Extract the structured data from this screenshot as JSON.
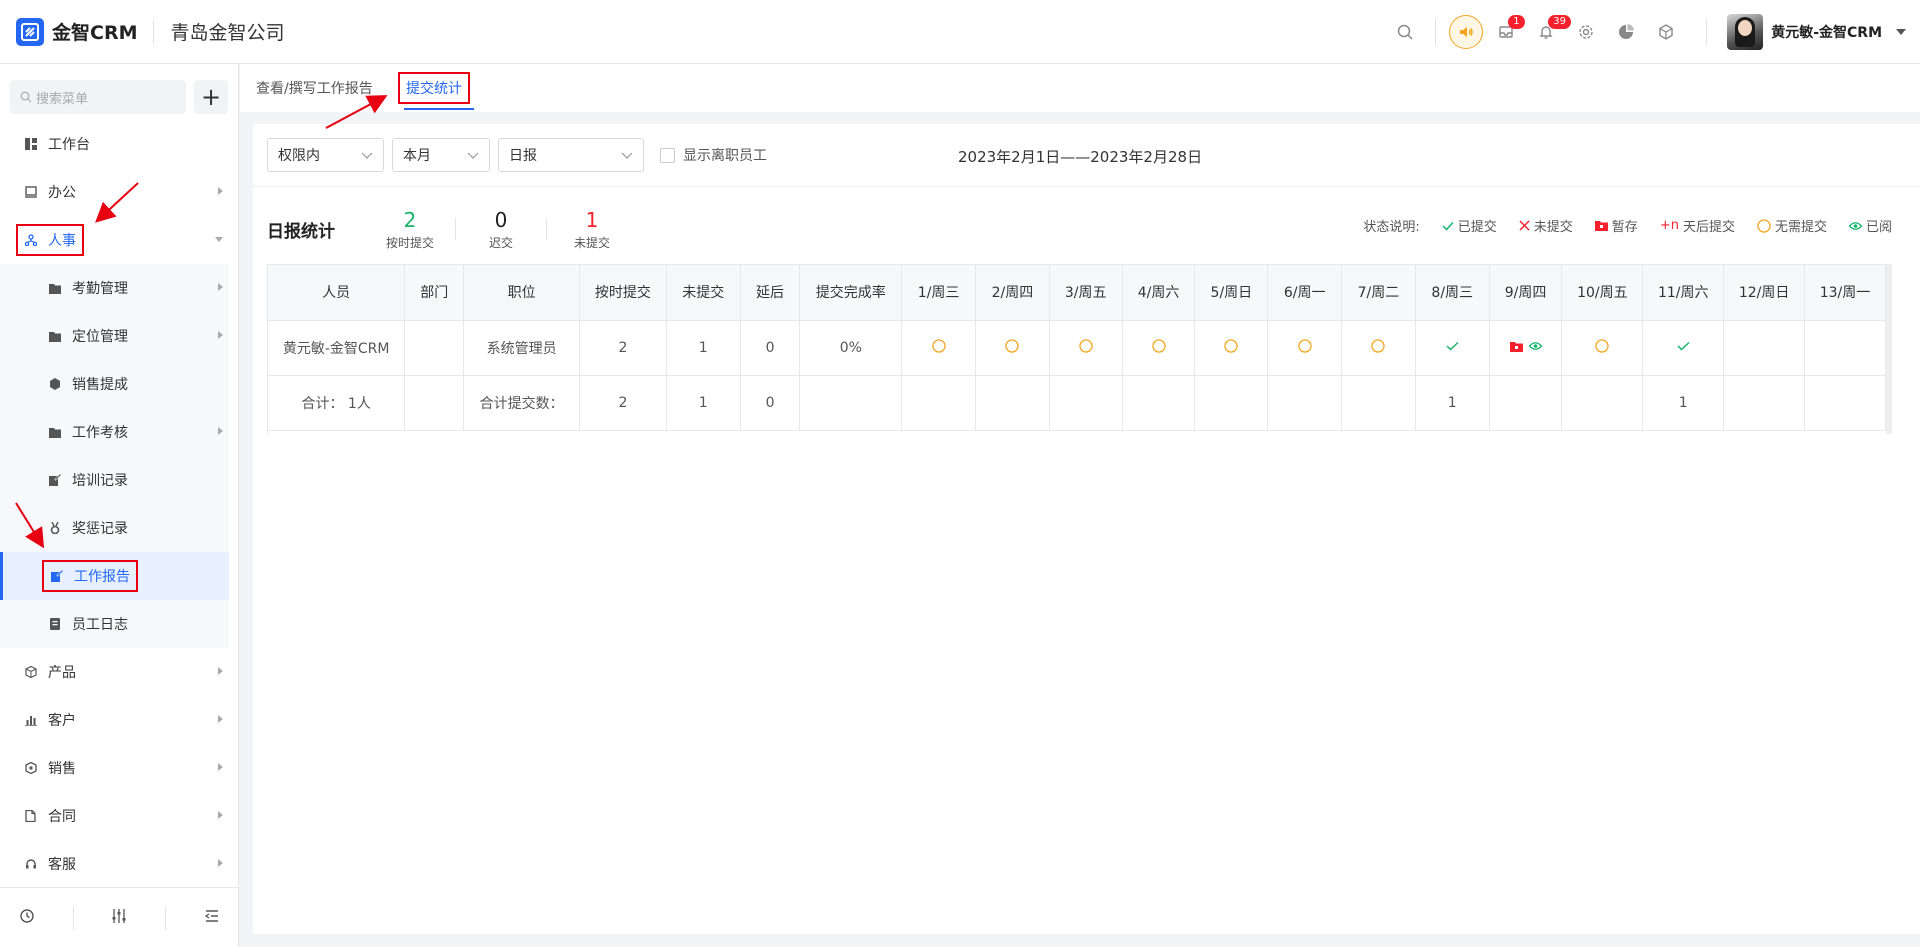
{
  "header": {
    "logo_text": "金智CRM",
    "company": "青岛金智公司",
    "message_badge": "1",
    "notify_badge": "39",
    "user_name": "黄元敏-金智CRM"
  },
  "sidebar": {
    "search_placeholder": "搜索菜单",
    "add_label": "+",
    "items": [
      {
        "label": "工作台"
      },
      {
        "label": "办公"
      },
      {
        "label": "人事"
      },
      {
        "label": "产品"
      },
      {
        "label": "客户"
      },
      {
        "label": "销售"
      },
      {
        "label": "合同"
      },
      {
        "label": "客服"
      }
    ],
    "sub_items": [
      {
        "label": "考勤管理"
      },
      {
        "label": "定位管理"
      },
      {
        "label": "销售提成"
      },
      {
        "label": "工作考核"
      },
      {
        "label": "培训记录"
      },
      {
        "label": "奖惩记录"
      },
      {
        "label": "工作报告"
      },
      {
        "label": "员工日志"
      }
    ]
  },
  "tabs": [
    {
      "label": "查看/撰写工作报告"
    },
    {
      "label": "提交统计"
    }
  ],
  "filters": {
    "scope": "权限内",
    "period": "本月",
    "report_type": "日报",
    "show_resigned": "显示离职员工",
    "date_range": "2023年2月1日——2023年2月28日"
  },
  "stats": {
    "title": "日报统计",
    "on_time": {
      "value": "2",
      "label": "按时提交"
    },
    "late": {
      "value": "0",
      "label": "迟交"
    },
    "missing": {
      "value": "1",
      "label": "未提交"
    }
  },
  "legend": {
    "title": "状态说明:",
    "submitted": "已提交",
    "not_submitted": "未提交",
    "draft": "暂存",
    "late_prefix": "+n",
    "late": "天后提交",
    "not_required": "无需提交",
    "read": "已阅"
  },
  "table": {
    "headers": [
      "人员",
      "部门",
      "职位",
      "按时提交",
      "未提交",
      "延后",
      "提交完成率",
      "1/周三",
      "2/周四",
      "3/周五",
      "4/周六",
      "5/周日",
      "6/周一",
      "7/周二",
      "8/周三",
      "9/周四",
      "10/周五",
      "11/周六",
      "12/周日",
      "13/周一"
    ],
    "row": {
      "person": "黄元敏-金智CRM",
      "dept": "",
      "position": "系统管理员",
      "on_time": "2",
      "missing": "1",
      "late": "0",
      "rate": "0%"
    },
    "day_status": [
      "none",
      "none",
      "none",
      "none",
      "none",
      "none",
      "none",
      "submitted",
      "draft-read",
      "none",
      "submitted",
      "",
      ""
    ],
    "total": {
      "person": "合计： 1人",
      "position": "合计提交数：",
      "on_time": "2",
      "missing": "1",
      "late": "0",
      "day8": "1",
      "day11": "1"
    }
  },
  "colors": {
    "accent": "#2468f2",
    "green": "#19b36b",
    "red": "#f5222d",
    "orange": "#f5a623",
    "annotation": "#e60012"
  }
}
